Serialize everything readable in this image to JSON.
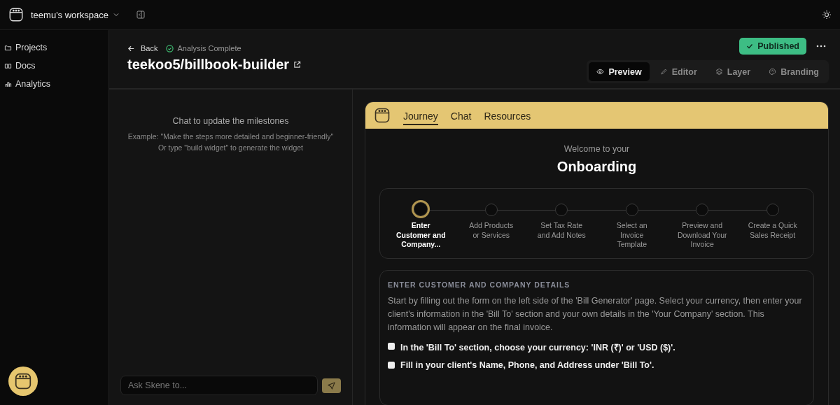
{
  "workspace": {
    "name": "teemu's workspace"
  },
  "sidebar": {
    "items": [
      {
        "label": "Projects"
      },
      {
        "label": "Docs"
      },
      {
        "label": "Analytics"
      }
    ]
  },
  "header": {
    "back": "Back",
    "status": "Analysis Complete",
    "title": "teekoo5/billbook-builder",
    "published": "Published"
  },
  "view_tabs": [
    {
      "label": "Preview",
      "selected": true
    },
    {
      "label": "Editor",
      "selected": false
    },
    {
      "label": "Layer",
      "selected": false
    },
    {
      "label": "Branding",
      "selected": false
    }
  ],
  "chat": {
    "title": "Chat to update the milestones",
    "example": "Example: \"Make the steps more detailed and beginner-friendly\"",
    "hint": "Or type \"build widget\" to generate the widget",
    "placeholder": "Ask Skene to..."
  },
  "preview": {
    "tabs": [
      {
        "label": "Journey",
        "selected": true
      },
      {
        "label": "Chat",
        "selected": false
      },
      {
        "label": "Resources",
        "selected": false
      }
    ],
    "welcome": "Welcome to your",
    "heading": "Onboarding",
    "steps": [
      {
        "label": "Enter Customer and Company...",
        "selected": true
      },
      {
        "label": "Add Products or Services",
        "selected": false
      },
      {
        "label": "Set Tax Rate and Add Notes",
        "selected": false
      },
      {
        "label": "Select an Invoice Template",
        "selected": false
      },
      {
        "label": "Preview and Download Your Invoice",
        "selected": false
      },
      {
        "label": "Create a Quick Sales Receipt",
        "selected": false
      }
    ],
    "section": {
      "title": "ENTER CUSTOMER AND COMPANY DETAILS",
      "text": "Start by filling out the form on the left side of the 'Bill Generator' page. Select your currency, then enter your client's information in the 'Bill To' section and your own details in the 'Your Company' section. This information will appear on the final invoice.",
      "tasks": [
        {
          "label": "In the 'Bill To' section, choose your currency: 'INR (₹)' or 'USD ($)'.",
          "checked": false
        },
        {
          "label": "Fill in your client's Name, Phone, and Address under 'Bill To'.",
          "checked": false
        }
      ]
    }
  }
}
